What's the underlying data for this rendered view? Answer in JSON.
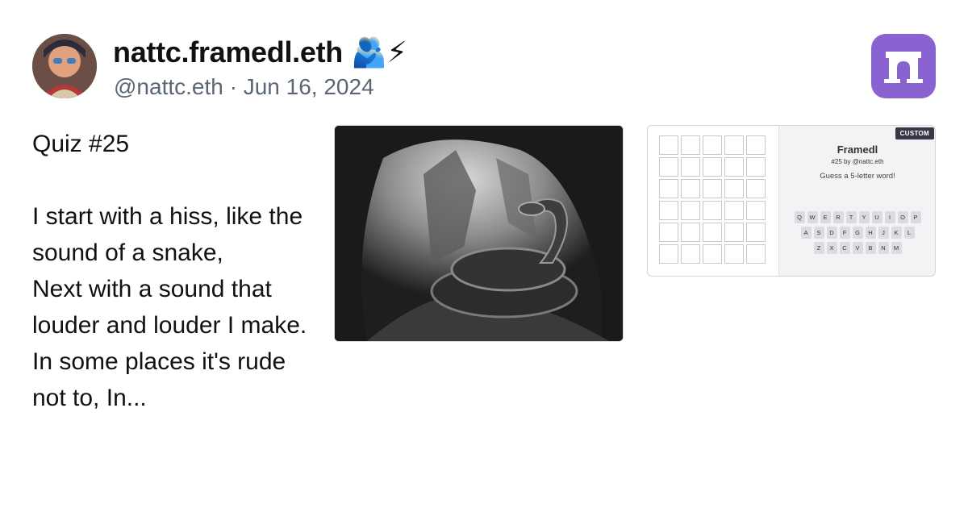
{
  "author": {
    "display_name": "nattc.framedl.eth",
    "badges": "🫂⚡",
    "handle": "@nattc.eth",
    "separator": "·",
    "date": "Jun 16, 2024"
  },
  "post": {
    "text": "Quiz #25\n\nI start with a hiss, like the sound of a snake,\nNext with a sound that louder and louder I make.\nIn some places it's rude not to, In..."
  },
  "frame": {
    "tag": "CUSTOM",
    "title": "Framedl",
    "subtitle": "#25 by @nattc.eth",
    "prompt": "Guess a 5-letter word!",
    "grid_rows": 6,
    "grid_cols": 5,
    "keyboard_rows": [
      [
        "Q",
        "W",
        "E",
        "R",
        "T",
        "Y",
        "U",
        "I",
        "O",
        "P"
      ],
      [
        "A",
        "S",
        "D",
        "F",
        "G",
        "H",
        "J",
        "K",
        "L"
      ],
      [
        "Z",
        "X",
        "C",
        "V",
        "B",
        "N",
        "M"
      ]
    ]
  },
  "icons": {
    "app_logo": "farcaster-arch-icon",
    "app_logo_color": "#8a63d2"
  }
}
